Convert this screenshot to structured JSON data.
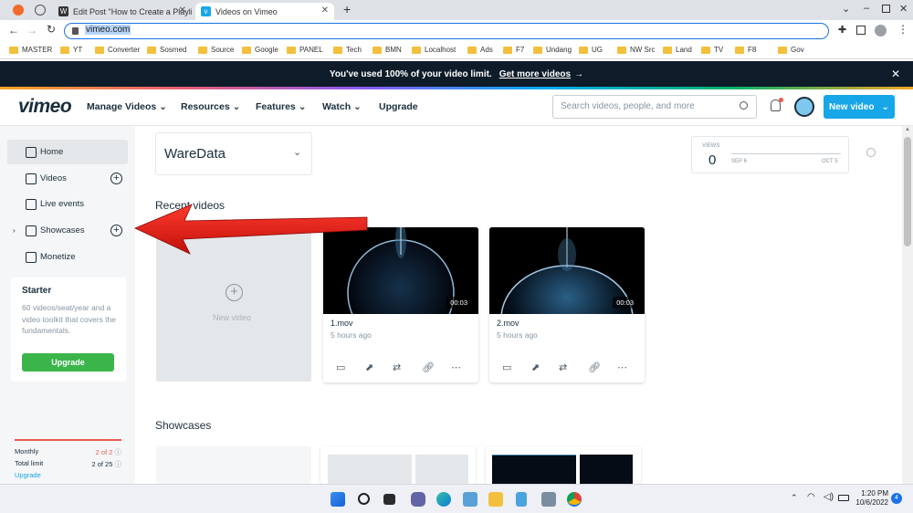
{
  "browser": {
    "tabs": [
      {
        "title": "Edit Post \"How to Create a Playli",
        "icon": "wordpress-icon"
      },
      {
        "title": "Videos on Vimeo",
        "icon": "vimeo-icon",
        "active": true
      }
    ],
    "url": "vimeo.com",
    "bookmarks": [
      "MASTER",
      "YT",
      "Converter",
      "Sosmed",
      "Source",
      "Google",
      "PANEL",
      "Tech",
      "BMN",
      "Localhost",
      "Ads",
      "F7",
      "Undang",
      "UG",
      "NW Src",
      "Land",
      "TV",
      "F8",
      "Gov"
    ]
  },
  "banner": {
    "text": "You've used 100% of your video limit.",
    "link": "Get more videos",
    "arrow": "→"
  },
  "header": {
    "logo": "vimeo",
    "nav": [
      "Manage Videos",
      "Resources",
      "Features",
      "Watch",
      "Upgrade"
    ],
    "search_placeholder": "Search videos, people, and more",
    "new_video": "New video"
  },
  "sidebar": {
    "items": [
      {
        "label": "Home",
        "icon": "home-icon",
        "selected": true
      },
      {
        "label": "Videos",
        "icon": "video-icon",
        "plus": true
      },
      {
        "label": "Live events",
        "icon": "camera-icon"
      },
      {
        "label": "Showcases",
        "icon": "showcase-icon",
        "plus": true
      },
      {
        "label": "Monetize",
        "icon": "monetize-icon"
      }
    ],
    "starter": {
      "title": "Starter",
      "desc": "60 videos/seat/year and a video toolkit that covers the fundamentals.",
      "button": "Upgrade"
    },
    "quota": {
      "monthly_label": "Monthly",
      "monthly_value": "2 of 2",
      "total_label": "Total limit",
      "total_value": "2 of 25",
      "upgrade": "Upgrade"
    }
  },
  "main": {
    "folder": "WareData",
    "views": {
      "label": "VIEWS",
      "value": "0",
      "start": "SEP 6",
      "end": "OCT 5"
    },
    "recent_title": "Recent videos",
    "new_video_label": "New video",
    "videos": [
      {
        "title": "1.mov",
        "time": "5 hours ago",
        "duration": "00:03"
      },
      {
        "title": "2.mov",
        "time": "5 hours ago",
        "duration": "00:03"
      }
    ],
    "showcases_title": "Showcases"
  },
  "taskbar": {
    "time": "1:20 PM",
    "date": "10/6/2022",
    "notifications": "4"
  },
  "colors": {
    "accent": "#17a6e8",
    "upgrade": "#3bb54a",
    "banner": "#0e1b28",
    "arrow": "#e8201a"
  }
}
